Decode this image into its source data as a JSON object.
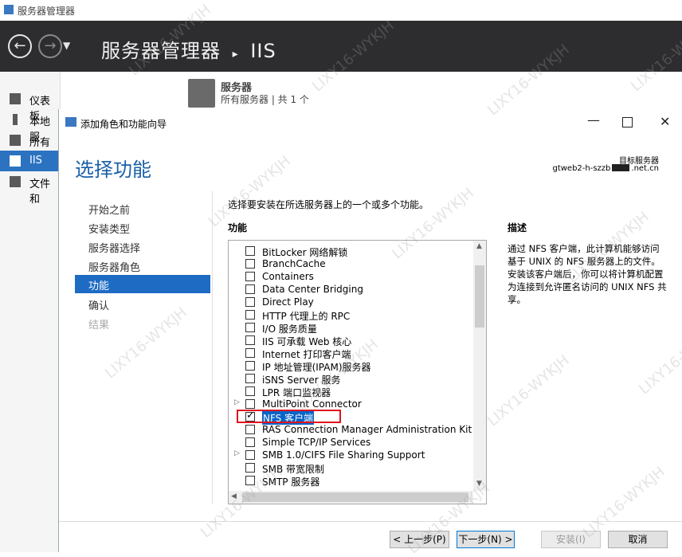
{
  "app": {
    "window_title": "服务器管理器",
    "breadcrumb_root": "服务器管理器",
    "breadcrumb_sep": "▸",
    "breadcrumb_current": "IIS"
  },
  "sidebar": {
    "items": [
      {
        "label": "仪表板",
        "icon": "dashboard-icon"
      },
      {
        "label": "本地服",
        "icon": "local-server-icon"
      },
      {
        "label": "所有服",
        "icon": "all-servers-icon"
      },
      {
        "label": "IIS",
        "icon": "iis-icon"
      },
      {
        "label": "文件和",
        "icon": "file-services-icon"
      }
    ]
  },
  "servers_panel": {
    "title": "服务器",
    "subtitle": "所有服务器 | 共 1 个"
  },
  "wizard": {
    "title": "添加角色和功能向导",
    "heading": "选择功能",
    "target_label": "目标服务器",
    "target_prefix": "gtweb2-h-szzb",
    "target_suffix": ".net.cn",
    "steps": [
      {
        "label": "开始之前",
        "state": "normal"
      },
      {
        "label": "安装类型",
        "state": "normal"
      },
      {
        "label": "服务器选择",
        "state": "normal"
      },
      {
        "label": "服务器角色",
        "state": "normal"
      },
      {
        "label": "功能",
        "state": "active"
      },
      {
        "label": "确认",
        "state": "normal"
      },
      {
        "label": "结果",
        "state": "disabled"
      }
    ],
    "intro": "选择要安装在所选服务器上的一个或多个功能。",
    "features_label": "功能",
    "description_label": "描述",
    "description": "通过 NFS 客户端，此计算机能够访问基于 UNIX 的 NFS 服务器上的文件。安装该客户端后，你可以将计算机配置为连接到允许匿名访问的 UNIX NFS 共享。",
    "features": [
      {
        "name": "BitLocker 网络解锁",
        "checked": false,
        "expandable": false
      },
      {
        "name": "BranchCache",
        "checked": false,
        "expandable": false
      },
      {
        "name": "Containers",
        "checked": false,
        "expandable": false
      },
      {
        "name": "Data Center Bridging",
        "checked": false,
        "expandable": false
      },
      {
        "name": "Direct Play",
        "checked": false,
        "expandable": false
      },
      {
        "name": "HTTP 代理上的 RPC",
        "checked": false,
        "expandable": false
      },
      {
        "name": "I/O 服务质量",
        "checked": false,
        "expandable": false
      },
      {
        "name": "IIS 可承载 Web 核心",
        "checked": false,
        "expandable": false
      },
      {
        "name": "Internet 打印客户端",
        "checked": false,
        "expandable": false
      },
      {
        "name": "IP 地址管理(IPAM)服务器",
        "checked": false,
        "expandable": false
      },
      {
        "name": "iSNS Server 服务",
        "checked": false,
        "expandable": false
      },
      {
        "name": "LPR 端口监视器",
        "checked": false,
        "expandable": false
      },
      {
        "name": "MultiPoint Connector",
        "checked": false,
        "expandable": true
      },
      {
        "name": "NFS 客户端",
        "checked": true,
        "expandable": false,
        "selected": true
      },
      {
        "name": "RAS Connection Manager Administration Kit (C",
        "checked": false,
        "expandable": false
      },
      {
        "name": "Simple TCP/IP Services",
        "checked": false,
        "expandable": false
      },
      {
        "name": "SMB 1.0/CIFS File Sharing Support",
        "checked": false,
        "expandable": true
      },
      {
        "name": "SMB 带宽限制",
        "checked": false,
        "expandable": false
      },
      {
        "name": "SMTP 服务器",
        "checked": false,
        "expandable": false
      }
    ],
    "buttons": {
      "prev": "< 上一步(P)",
      "next": "下一步(N) >",
      "install": "安装(I)",
      "cancel": "取消"
    }
  },
  "watermark": "LIXY16-WYKJH",
  "colors": {
    "accent": "#1e6bc4",
    "header_bg": "#2d2d30",
    "highlight_border": "#e0141c"
  }
}
